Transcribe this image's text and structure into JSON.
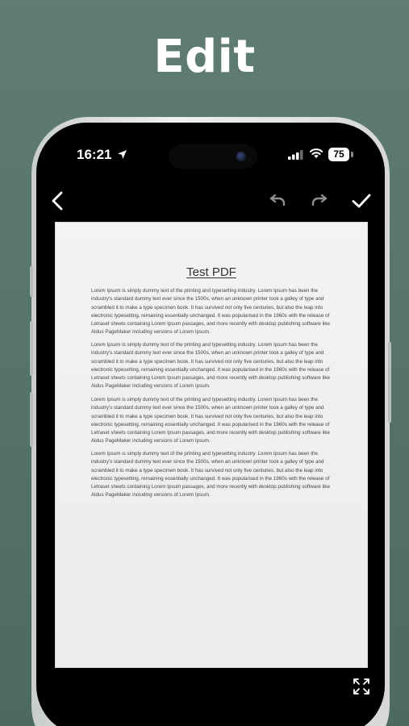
{
  "header": {
    "title": "Edit"
  },
  "status_bar": {
    "time": "16:21",
    "battery": "75",
    "icons": [
      "location-arrow-icon",
      "cellular-signal-icon",
      "wifi-icon",
      "battery-icon"
    ]
  },
  "toolbar": {
    "icons": [
      "back-chevron-icon",
      "undo-icon",
      "redo-icon",
      "check-icon"
    ]
  },
  "document": {
    "title": "Test PDF",
    "paragraphs": [
      "Lorem Ipsum is simply dummy text of the printing and typesetting industry. Lorem Ipsum has been the industry's standard dummy text ever since the 1500s, when an unknown printer took a galley of type and scrambled it to make a type specimen book. It has survived not only five centuries, but also the leap into electronic typesetting, remaining essentially unchanged. It was popularised in the 1960s with the release of Letraset sheets containing Lorem Ipsum passages, and more recently with desktop publishing software like Aldus PageMaker including versions of Lorem Ipsum.",
      "Lorem Ipsum is simply dummy text of the printing and typesetting industry. Lorem Ipsum has been the industry's standard dummy text ever since the 1500s, when an unknown printer took a galley of type and scrambled it to make a type specimen book. It has survived not only five centuries, but also the leap into electronic typesetting, remaining essentially unchanged. It was popularised in the 1960s with the release of Letraset sheets containing Lorem Ipsum passages, and more recently with desktop publishing software like Aldus PageMaker including versions of Lorem Ipsum.",
      "Lorem Ipsum is simply dummy text of the printing and typesetting industry. Lorem Ipsum has been the industry's standard dummy text ever since the 1500s, when an unknown printer took a galley of type and scrambled it to make a type specimen book. It has survived not only five centuries, but also the leap into electronic typesetting, remaining essentially unchanged. It was popularised in the 1960s with the release of Letraset sheets containing Lorem Ipsum passages, and more recently with desktop publishing software like Aldus PageMaker including versions of Lorem Ipsum.",
      "Lorem Ipsum is simply dummy text of the printing and typesetting industry. Lorem Ipsum has been the industry's standard dummy text ever since the 1500s, when an unknown printer took a galley of type and scrambled it to make a type specimen book. It has survived not only five centuries, but also the leap into electronic typesetting, remaining essentially unchanged. It was popularised in the 1960s with the release of Letraset sheets containing Lorem Ipsum passages, and more recently with desktop publishing software like Aldus PageMaker including versions of Lorem Ipsum."
    ]
  },
  "bottom_bar": {
    "icons": [
      "expand-icon"
    ]
  },
  "colors": {
    "background": "#567367",
    "screen": "#000000",
    "paper": "#f0f0ef",
    "text": "#444444"
  }
}
